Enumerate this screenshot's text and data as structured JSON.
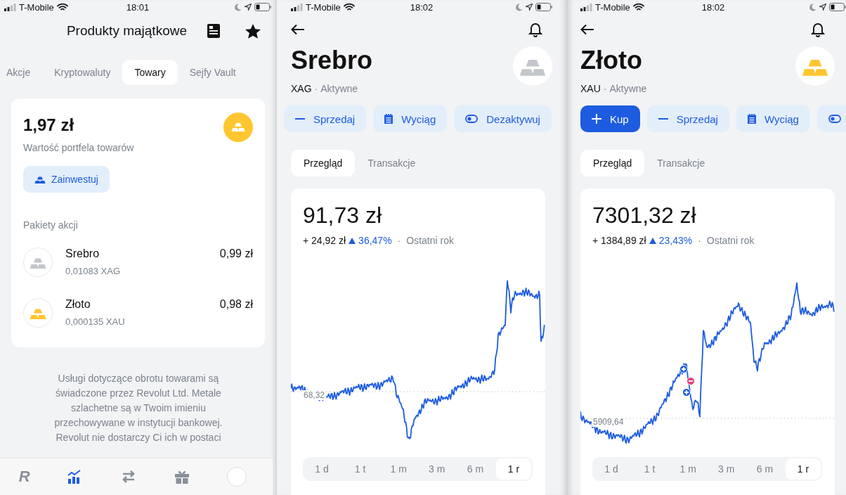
{
  "screens": [
    {
      "kind": "portfolio",
      "status_bar": {
        "carrier": "T-Mobile",
        "time": "18:01"
      },
      "title": "Produkty majątkowe",
      "tabs": [
        {
          "label": "Akcje",
          "selected": false
        },
        {
          "label": "Kryptowaluty",
          "selected": false
        },
        {
          "label": "Towary",
          "selected": true
        },
        {
          "label": "Sejfy Vault",
          "selected": false
        }
      ],
      "summary": {
        "amount": "1,97 zł",
        "caption": "Wartość portfela towarów",
        "button": "Zainwestuj"
      },
      "section_title": "Pakiety akcji",
      "holdings": [
        {
          "name": "Srebro",
          "color": "#c3c6cb",
          "quantity": "0,01083  XAG",
          "value": "0,99 zł"
        },
        {
          "name": "Złoto",
          "color": "#ffc62f",
          "quantity": "0,000135  XAU",
          "value": "0,98 zł"
        }
      ],
      "disclaimer": "Usługi dotyczące obrotu towarami są świadczone przez Revolut Ltd. Metale szlachetne są w Twoim imieniu przechowywane w instytucji bankowej. Revolut nie dostarczy Ci ich w postaci",
      "nav": [
        {
          "kind": "logo",
          "label": "R",
          "selected": false
        },
        {
          "kind": "invest",
          "selected": true
        },
        {
          "kind": "transfer",
          "selected": false
        },
        {
          "kind": "gift",
          "selected": false
        },
        {
          "kind": "avatar",
          "selected": false
        }
      ]
    },
    {
      "kind": "detail",
      "status_bar": {
        "carrier": "T-Mobile",
        "time": "18:02"
      },
      "title": "Srebro",
      "color": "#c3c6cb",
      "code": "XAG",
      "separator": "·",
      "state": "Aktywne",
      "actions": [
        {
          "kind": "sell",
          "label": "Sprzedaj"
        },
        {
          "kind": "statement",
          "label": "Wyciąg"
        },
        {
          "kind": "toggle",
          "label": "Dezaktywuj"
        }
      ],
      "tabs": [
        {
          "label": "Przegląd",
          "selected": true
        },
        {
          "label": "Transakcje",
          "selected": false
        }
      ],
      "price": "91,73 zł",
      "change": "+ 24,92 zł",
      "percent": "36,47%",
      "period_separator": "·",
      "period": "Ostatni rok",
      "baseline": "68,32",
      "ranges": [
        {
          "label": "1 d",
          "selected": false
        },
        {
          "label": "1 t",
          "selected": false
        },
        {
          "label": "1 m",
          "selected": false
        },
        {
          "label": "3 m",
          "selected": false
        },
        {
          "label": "6 m",
          "selected": false
        },
        {
          "label": "1 r",
          "selected": true
        }
      ]
    },
    {
      "kind": "detail",
      "status_bar": {
        "carrier": "T-Mobile",
        "time": "18:02"
      },
      "title": "Złoto",
      "color": "#ffc62f",
      "code": "XAU",
      "separator": "·",
      "state": "Aktywne",
      "actions": [
        {
          "kind": "buy",
          "label": "Kup"
        },
        {
          "kind": "sell",
          "label": "Sprzedaj"
        },
        {
          "kind": "statement",
          "label": "Wyciąg"
        },
        {
          "kind": "toggle"
        }
      ],
      "tabs": [
        {
          "label": "Przegląd",
          "selected": true
        },
        {
          "label": "Transakcje",
          "selected": false
        }
      ],
      "price": "7301,32 zł",
      "change": "+ 1384,89 zł",
      "percent": "23,43%",
      "period_separator": "·",
      "period": "Ostatni rok",
      "baseline": "5909,64",
      "ranges": [
        {
          "label": "1 d",
          "selected": false
        },
        {
          "label": "1 t",
          "selected": false
        },
        {
          "label": "1 m",
          "selected": false
        },
        {
          "label": "3 m",
          "selected": false
        },
        {
          "label": "6 m",
          "selected": false
        },
        {
          "label": "1 r",
          "selected": true
        }
      ]
    }
  ]
}
